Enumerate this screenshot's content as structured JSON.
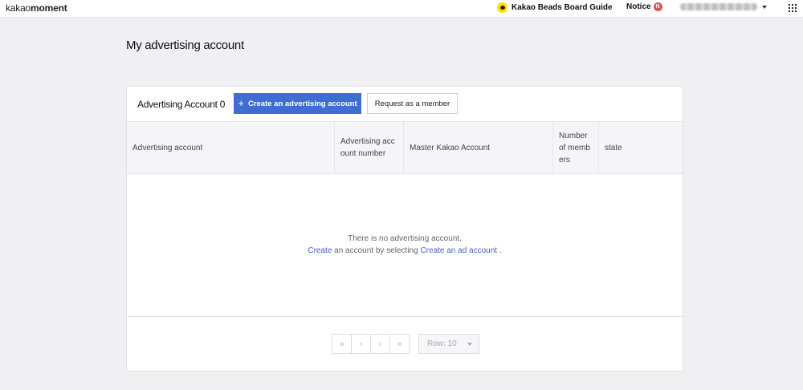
{
  "header": {
    "logo_light": "kakao",
    "logo_bold": "moment",
    "guide_label": "Kakao Beads Board Guide",
    "notice_label": "Notice",
    "notice_badge": "N"
  },
  "page": {
    "title": "My advertising account"
  },
  "card": {
    "title": "Advertising Account 0",
    "create_button_icon": "+",
    "create_button_label": "Create an advertising account",
    "request_button_label": "Request as a member"
  },
  "table": {
    "columns": [
      "Advertising account",
      "Advertising acc\nount number",
      "Master Kakao Account",
      "Number\nof memb\ners",
      "state"
    ]
  },
  "empty": {
    "line1": "There is no advertising account.",
    "line2_link1": "Create",
    "line2_mid": " an account by selecting ",
    "line2_link2": "Create an ad account",
    "line2_end": " ."
  },
  "pagination": {
    "first": "«",
    "prev": "‹",
    "next": "›",
    "last": "»",
    "rows_label": "Row: 10"
  },
  "colors": {
    "primary": "#3f6ed3",
    "link": "#3f63c4",
    "kakao_yellow": "#fae100",
    "notice_red": "#e25151"
  },
  "icons": {
    "guide": "kakao-talk-icon",
    "apps": "grid-apps-icon",
    "user_menu": "caret-down-icon"
  }
}
